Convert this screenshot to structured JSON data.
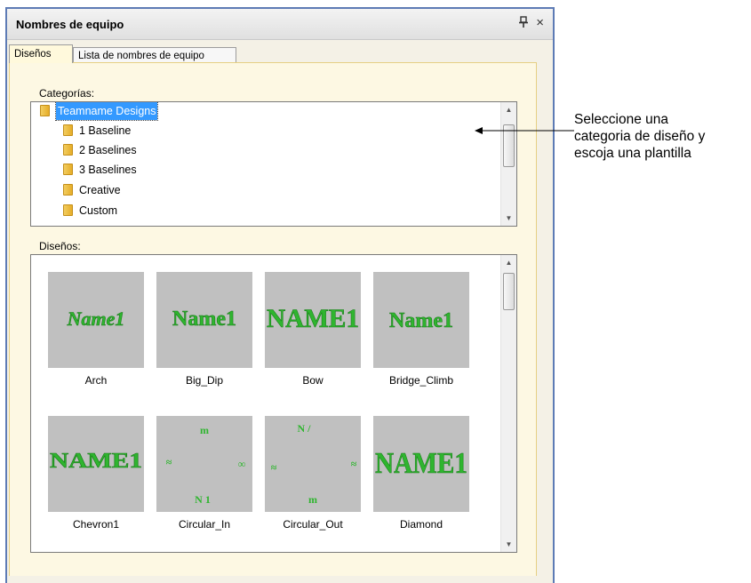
{
  "panel": {
    "title": "Nombres de equipo",
    "pin_glyph": "&#x1F4CC;",
    "close_glyph": "×"
  },
  "tabs": [
    {
      "label": "Diseños",
      "active": true
    },
    {
      "label": "Lista de nombres de equipo",
      "active": false
    }
  ],
  "categories": {
    "label": "Categorías:",
    "items": [
      {
        "label": "Teamname Designs",
        "selected": true,
        "level": 0
      },
      {
        "label": "1 Baseline",
        "level": 1
      },
      {
        "label": "2 Baselines",
        "level": 1
      },
      {
        "label": "3 Baselines",
        "level": 1
      },
      {
        "label": "Creative",
        "level": 1
      },
      {
        "label": "Custom",
        "level": 1
      }
    ]
  },
  "designs": {
    "label": "Diseños:",
    "items": [
      {
        "name": "Arch"
      },
      {
        "name": "Big_Dip"
      },
      {
        "name": "Bow"
      },
      {
        "name": "Bridge_Climb"
      },
      {
        "name": "Chevron1"
      },
      {
        "name": "Circular_In"
      },
      {
        "name": "Circular_Out"
      },
      {
        "name": "Diamond"
      }
    ],
    "thumb_text": {
      "arch": "Name1",
      "big_dip": "Name1",
      "bow": "NAME1",
      "bridge": "Name1",
      "chevron": "NAME1",
      "diamond": "NAME1",
      "circ_in_top": "m",
      "circ_in_left": "≈",
      "circ_in_right": "∞",
      "circ_in_bottom": "N 1",
      "circ_out_top": "N /",
      "circ_out_left": "≈",
      "circ_out_right": "≈",
      "circ_out_bottom": "m"
    }
  },
  "callout": {
    "line1": "Seleccione una",
    "line2": "categoria de diseño y",
    "line3": "escoja una plantilla"
  },
  "colors": {
    "panel_border": "#5d7bb5",
    "selection": "#3399ff",
    "thumb_bg": "#c0c0c0",
    "embroidery_green": "#2fb52f"
  }
}
